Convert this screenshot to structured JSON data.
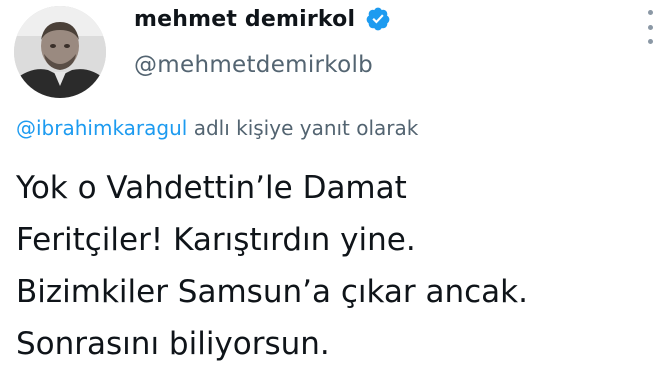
{
  "tweet": {
    "author": {
      "display_name": "mehmet demirkol",
      "handle": "@mehmetdemirkolb",
      "verified": true,
      "avatar_icon": "person-photo-avatar"
    },
    "menu_icon": "more-vertical-icon",
    "reply_context": {
      "mention": "@ibrahimkaragul",
      "suffix": " adlı kişiye yanıt olarak"
    },
    "text_lines": [
      "Yok o Vahdettin’le Damat",
      "Feritçiler! Karıştırdın yine.",
      "Bizimkiler Samsun’a çıkar ancak.",
      "Sonrasını biliyorsun."
    ]
  },
  "colors": {
    "text_primary": "#0f1419",
    "text_secondary": "#536471",
    "accent_blue": "#1d9bf0",
    "background": "#ffffff"
  }
}
